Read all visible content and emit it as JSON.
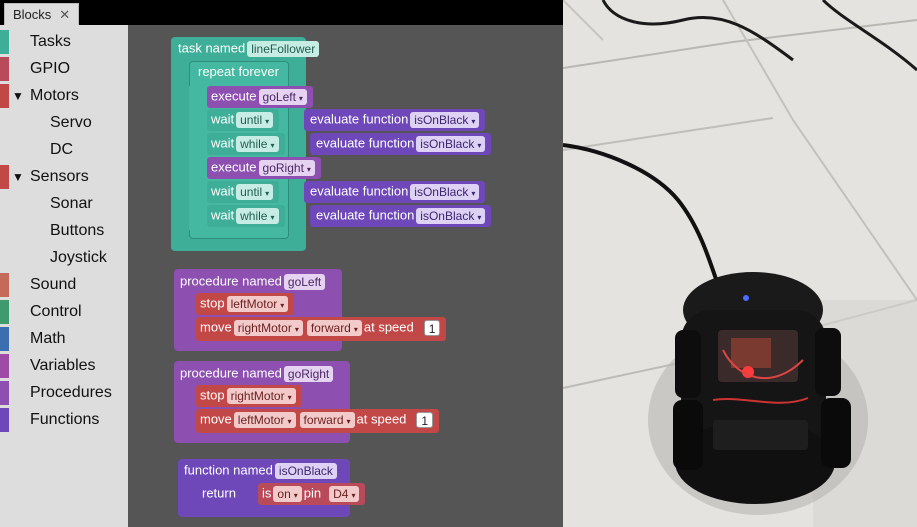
{
  "tab": {
    "label": "Blocks",
    "close": "✕"
  },
  "toolbox": {
    "categories": [
      {
        "label": "Tasks",
        "color": "#3fae98"
      },
      {
        "label": "GPIO",
        "color": "#b84a5a"
      },
      {
        "label": "Motors",
        "color": "#c24848",
        "expanded": true
      },
      {
        "label": "Servo"
      },
      {
        "label": "DC"
      },
      {
        "label": "Sensors",
        "color": "#c24848",
        "expanded": true
      },
      {
        "label": "Sonar"
      },
      {
        "label": "Buttons"
      },
      {
        "label": "Joystick"
      },
      {
        "label": "Sound",
        "color": "#c46a5a"
      },
      {
        "label": "Control",
        "color": "#3f9a6e"
      },
      {
        "label": "Math",
        "color": "#3b6fb0"
      },
      {
        "label": "Variables",
        "color": "#a04aa8"
      },
      {
        "label": "Procedures",
        "color": "#8d4fb0"
      },
      {
        "label": "Functions",
        "color": "#6e48b8"
      }
    ],
    "expand_glyph": "▼"
  },
  "blocks": {
    "task": {
      "label": "task named",
      "name": "lineFollower"
    },
    "repeat": {
      "label": "repeat forever"
    },
    "exec1": {
      "label": "execute",
      "value": "goLeft"
    },
    "wait1": {
      "label": "wait",
      "mode": "until",
      "eval": "evaluate function",
      "func": "isOnBlack"
    },
    "wait2": {
      "label": "wait",
      "mode": "while",
      "eval": "evaluate function",
      "func": "isOnBlack"
    },
    "exec2": {
      "label": "execute",
      "value": "goRight"
    },
    "wait3": {
      "label": "wait",
      "mode": "until",
      "eval": "evaluate function",
      "func": "isOnBlack"
    },
    "wait4": {
      "label": "wait",
      "mode": "while",
      "eval": "evaluate function",
      "func": "isOnBlack"
    },
    "proc1": {
      "label": "procedure named",
      "name": "goLeft",
      "stop": "stop",
      "stop_motor": "leftMotor",
      "move": "move",
      "move_motor": "rightMotor",
      "direction": "forward",
      "at_speed": "at speed",
      "speed": "1"
    },
    "proc2": {
      "label": "procedure named",
      "name": "goRight",
      "stop": "stop",
      "stop_motor": "rightMotor",
      "move": "move",
      "move_motor": "leftMotor",
      "direction": "forward",
      "at_speed": "at speed",
      "speed": "1"
    },
    "func": {
      "label": "function named",
      "name": "isOnBlack",
      "return": "return",
      "is": "is",
      "state": "on",
      "pin_label": "pin",
      "pin": "D4"
    }
  },
  "dropdown_glyph": "▾",
  "colors": {
    "task": "#3fae98",
    "procedure": "#8d4fb0",
    "function": "#6e48b8",
    "motor": "#c24848"
  }
}
